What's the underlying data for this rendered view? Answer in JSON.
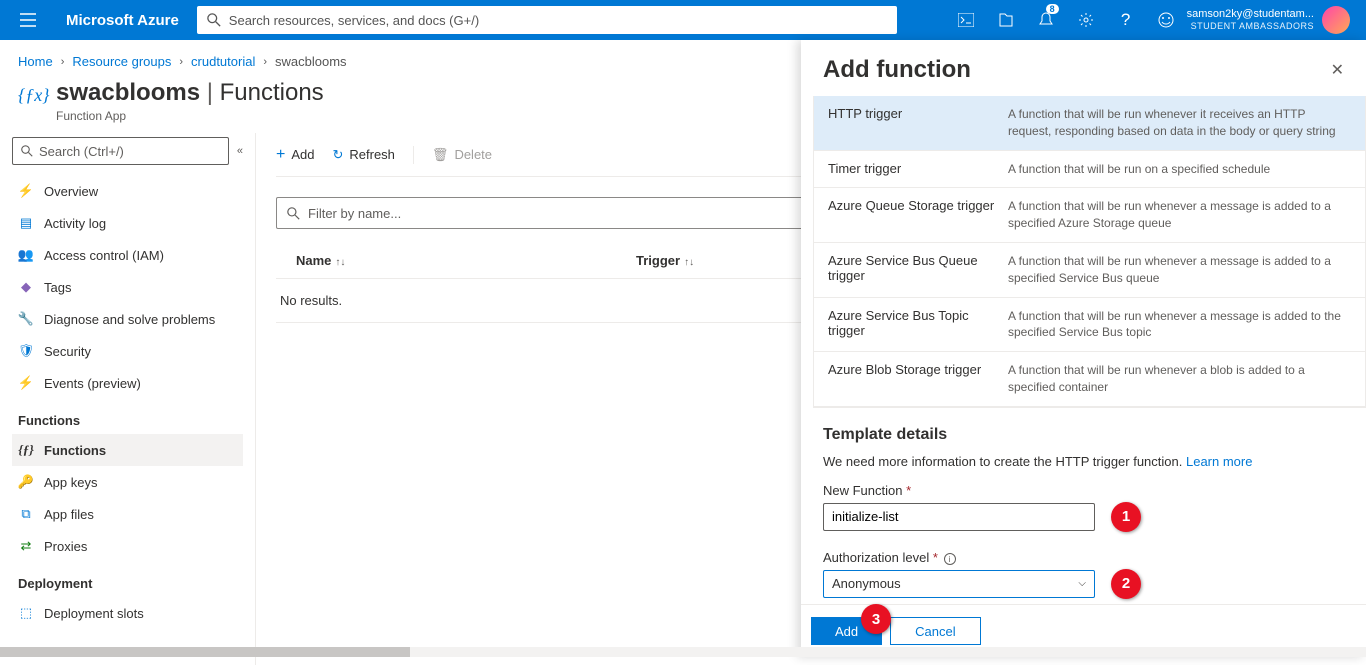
{
  "topbar": {
    "brand": "Microsoft Azure",
    "search_placeholder": "Search resources, services, and docs (G+/)",
    "notification_badge": "8",
    "user_email": "samson2ky@studentam...",
    "user_role": "STUDENT AMBASSADORS"
  },
  "breadcrumb": {
    "items": [
      "Home",
      "Resource groups",
      "crudtutorial",
      "swacblooms"
    ]
  },
  "page": {
    "title_main": "swacblooms",
    "title_sep": " | ",
    "title_sub": "Functions",
    "subtitle": "Function App"
  },
  "sidebar": {
    "search_placeholder": "Search (Ctrl+/)",
    "items": [
      {
        "label": "Overview",
        "icon": "lightning",
        "color": "#ffb900"
      },
      {
        "label": "Activity log",
        "icon": "log",
        "color": "#0078d4"
      },
      {
        "label": "Access control (IAM)",
        "icon": "people",
        "color": "#605e5c"
      },
      {
        "label": "Tags",
        "icon": "tag",
        "color": "#8764b8"
      },
      {
        "label": "Diagnose and solve problems",
        "icon": "wrench",
        "color": "#323130"
      },
      {
        "label": "Security",
        "icon": "shield",
        "color": "#0078d4"
      },
      {
        "label": "Events (preview)",
        "icon": "bolt",
        "color": "#ffb900"
      }
    ],
    "section_functions": "Functions",
    "functions_items": [
      {
        "label": "Functions",
        "icon": "fx",
        "active": true
      },
      {
        "label": "App keys",
        "icon": "key",
        "color": "#ffb900"
      },
      {
        "label": "App files",
        "icon": "files",
        "color": "#0078d4"
      },
      {
        "label": "Proxies",
        "icon": "proxy",
        "color": "#107c10"
      }
    ],
    "section_deployment": "Deployment",
    "deployment_items": [
      {
        "label": "Deployment slots",
        "icon": "slots",
        "color": "#0078d4"
      }
    ]
  },
  "toolbar": {
    "add": "Add",
    "refresh": "Refresh",
    "delete": "Delete"
  },
  "filter": {
    "placeholder": "Filter by name..."
  },
  "table": {
    "col_name": "Name",
    "col_trigger": "Trigger",
    "no_results": "No results."
  },
  "panel": {
    "title": "Add function",
    "templates": [
      {
        "name": "HTTP trigger",
        "desc": "A function that will be run whenever it receives an HTTP request, responding based on data in the body or query string",
        "selected": true
      },
      {
        "name": "Timer trigger",
        "desc": "A function that will be run on a specified schedule"
      },
      {
        "name": "Azure Queue Storage trigger",
        "desc": "A function that will be run whenever a message is added to a specified Azure Storage queue"
      },
      {
        "name": "Azure Service Bus Queue trigger",
        "desc": "A function that will be run whenever a message is added to a specified Service Bus queue"
      },
      {
        "name": "Azure Service Bus Topic trigger",
        "desc": "A function that will be run whenever a message is added to the specified Service Bus topic"
      },
      {
        "name": "Azure Blob Storage trigger",
        "desc": "A function that will be run whenever a blob is added to a specified container"
      }
    ],
    "details_title": "Template details",
    "details_desc": "We need more information to create the HTTP trigger function. ",
    "learn_more": "Learn more",
    "field_name_label": "New Function",
    "field_name_value": "initialize-list",
    "field_auth_label": "Authorization level",
    "field_auth_value": "Anonymous",
    "btn_add": "Add",
    "btn_cancel": "Cancel"
  },
  "callouts": {
    "c1": "1",
    "c2": "2",
    "c3": "3"
  }
}
